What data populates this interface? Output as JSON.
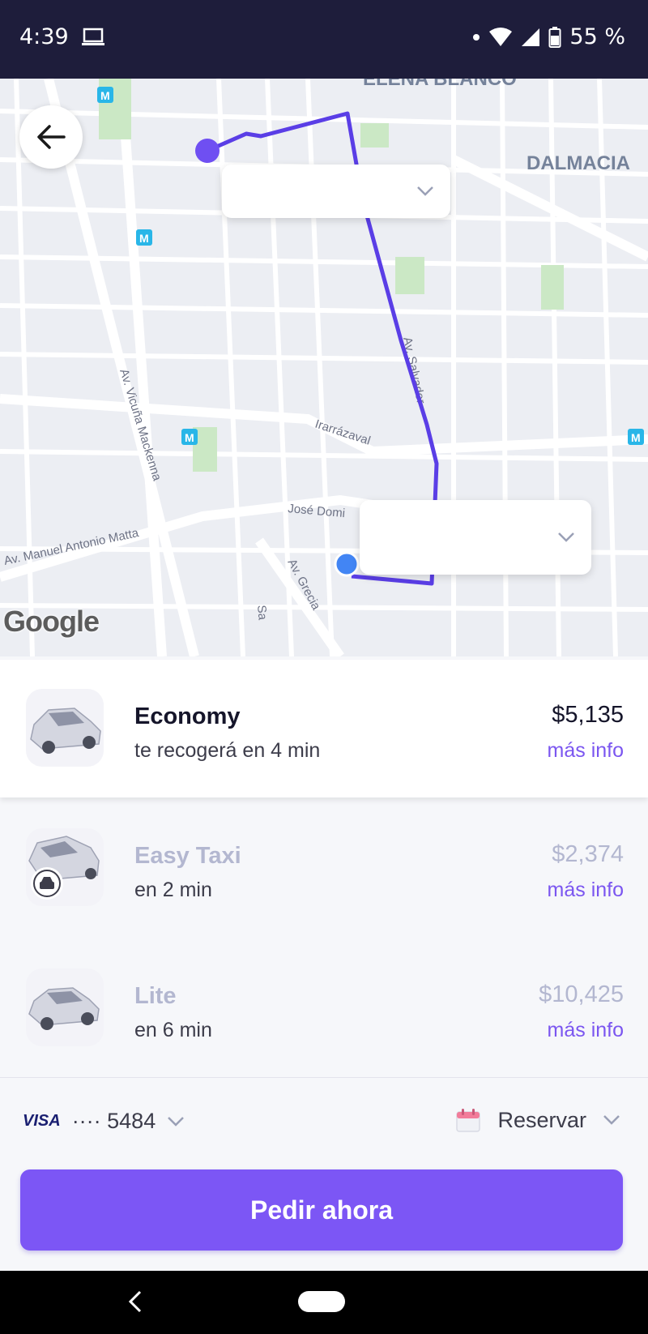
{
  "status_bar": {
    "time": "4:39",
    "battery": "55 %"
  },
  "map": {
    "neighborhoods": [
      "ELENA BLANCO",
      "DALMACIA"
    ],
    "streets": [
      "Av. Vicuña Mackenna",
      "Irarrázaval",
      "José Domi",
      "Av. Manuel Antonio Matta",
      "Av. Grecia",
      "Av. Salvador",
      "Sa"
    ],
    "metro_marker": "M",
    "attribution": "Google",
    "origin_label": "",
    "destination_label": ""
  },
  "rides": [
    {
      "name": "Economy",
      "subtitle": "te recogerá en 4 min",
      "price": "$5,135",
      "info": "más info",
      "selected": true
    },
    {
      "name": "Easy Taxi",
      "subtitle": "en 2 min",
      "price": "$2,374",
      "info": "más info",
      "selected": false
    },
    {
      "name": "Lite",
      "subtitle": "en 6 min",
      "price": "$10,425",
      "info": "más info",
      "selected": false
    }
  ],
  "payment": {
    "brand": "VISA",
    "card": "···· 5484"
  },
  "reserve": {
    "label": "Reservar"
  },
  "cta": {
    "label": "Pedir ahora"
  },
  "colors": {
    "accent": "#7c56f5",
    "route": "#5a3ee6",
    "status_bar": "#1e1d3b"
  },
  "icons": [
    "laptop-icon",
    "wifi-icon",
    "signal-icon",
    "battery-icon",
    "back-arrow-icon",
    "chevron-down-icon",
    "calendar-icon",
    "taxi-icon",
    "nav-back-icon"
  ]
}
